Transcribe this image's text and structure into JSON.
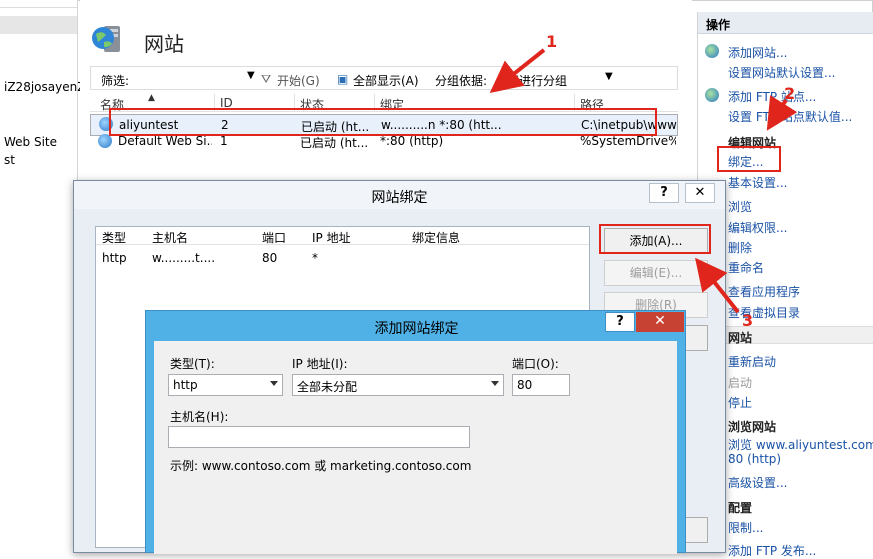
{
  "tree": {
    "items": [
      "iZ28josayenZ",
      "Web Site",
      "st"
    ]
  },
  "header": {
    "title": "网站"
  },
  "filterbar": {
    "label": "筛选:",
    "start": "开始(G)",
    "show_all": "全部显示(A)",
    "group_by": "分组依据:",
    "group_value": "不进行分组"
  },
  "columns": [
    "名称",
    "ID",
    "状态",
    "绑定",
    "路径"
  ],
  "sites": [
    {
      "name": "aliyuntest",
      "id": "2",
      "status": "已启动 (ht...",
      "binding": "w..........n *:80 (htt...",
      "path": "C:\\inetpub\\wwwr"
    },
    {
      "name": "Default Web Si...",
      "id": "1",
      "status": "已启动 (ht...",
      "binding": "*:80 (http)",
      "path": "%SystemDrive%\\"
    }
  ],
  "actions": {
    "header": "操作",
    "add_site": "添加网站...",
    "set_defaults": "设置网站默认设置...",
    "add_ftp": "添加 FTP 站点...",
    "ftp_defaults": "设置 FTP 站点默认值...",
    "edit_site": "编辑网站",
    "bindings": "绑定...",
    "basic_settings": "基本设置...",
    "browse": "浏览",
    "edit_perms": "编辑权限...",
    "delete": "删除",
    "rename": "重命名",
    "view_apps": "查看应用程序",
    "view_vdirs": "查看虚拟目录",
    "manage_site": "网站",
    "restart": "重新启动",
    "start": "启动",
    "stop": "停止",
    "browse_site": "浏览网站",
    "browse_url": "浏览 www.aliyuntest.com",
    "browse_port": "80 (http)",
    "advanced": "高级设置...",
    "configure": "配置",
    "limits": "限制...",
    "add_ftp_publish": "添加 FTP 发布..."
  },
  "bindings_dialog": {
    "title": "网站绑定",
    "help": "?",
    "close": "✕",
    "columns": [
      "类型",
      "主机名",
      "端口",
      "IP 地址",
      "绑定信息"
    ],
    "rows": [
      {
        "type": "http",
        "host": "w.........t....",
        "port": "80",
        "ip": "*",
        "info": ""
      }
    ],
    "add": "添加(A)...",
    "edit": "编辑(E)...",
    "remove": "删除(R)"
  },
  "add_binding_dialog": {
    "title": "添加网站绑定",
    "help": "?",
    "close": "✕",
    "type_label": "类型(T):",
    "type_value": "http",
    "ip_label": "IP 地址(I):",
    "ip_value": "全部未分配",
    "port_label": "端口(O):",
    "port_value": "80",
    "host_label": "主机名(H):",
    "host_value": "",
    "example": "示例: www.contoso.com 或 marketing.contoso.com"
  },
  "annotations": [
    "1",
    "2",
    "3"
  ],
  "colors": {
    "annotation": "#e0261c",
    "link": "#1a52a6",
    "dialog_title": "#4fb1e6"
  }
}
